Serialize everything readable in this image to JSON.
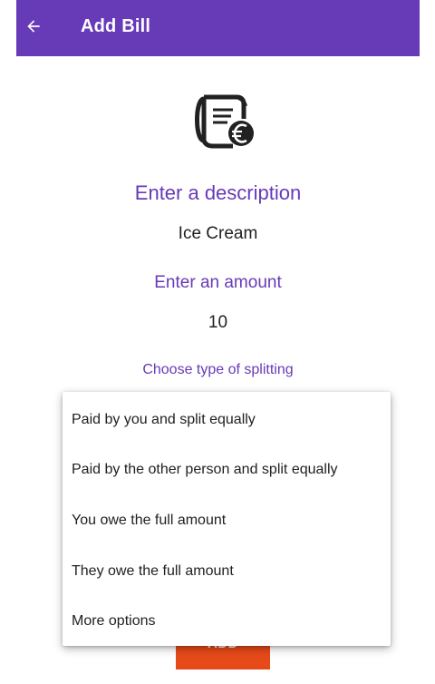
{
  "app_bar": {
    "title": "Add Bill",
    "color": "#673ab7"
  },
  "icons": {
    "back": "arrow-left-icon",
    "receipt": "receipt-euro-icon"
  },
  "form": {
    "description_label": "Enter a description",
    "description_value": "Ice Cream",
    "amount_label": "Enter an amount",
    "amount_value": "10",
    "split_label": "Choose type of splitting"
  },
  "split_menu": {
    "options": [
      "Paid by you and split equally",
      "Paid by the other person and split equally",
      "You owe the full amount",
      "They owe the full amount",
      "More options"
    ]
  },
  "add_button": {
    "label": "ADD",
    "color": "#e64a19"
  }
}
